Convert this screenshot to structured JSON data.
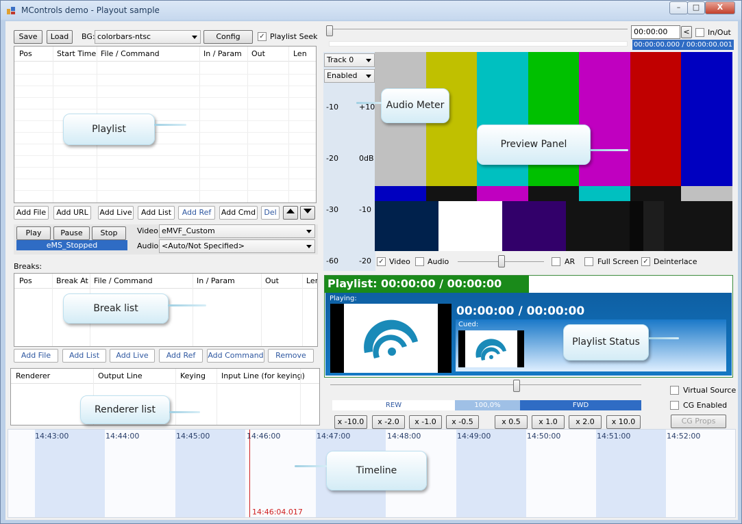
{
  "window": {
    "title": "MControls demo - Playout sample",
    "controls": {
      "minimize": "–",
      "maximize": "□",
      "close": "X"
    }
  },
  "toolbar": {
    "save": "Save",
    "load": "Load",
    "bg_label": "BG:",
    "bg_value": "colorbars-ntsc",
    "config": "Config",
    "playlist_seek": "Playlist Seek"
  },
  "playlist": {
    "columns": [
      "Pos",
      "Start Time",
      "File / Command",
      "In / Param",
      "Out",
      "Len"
    ],
    "buttons": [
      "Add File",
      "Add URL",
      "Add Live",
      "Add List",
      "Add Ref",
      "Add Cmd",
      "Del"
    ]
  },
  "transport": {
    "play": "Play",
    "pause": "Pause",
    "stop": "Stop",
    "status": "eMS_Stopped",
    "video_label": "Video:",
    "video_value": "eMVF_Custom",
    "audio_label": "Audio:",
    "audio_value": "<Auto/Not Specified>"
  },
  "breaks": {
    "label": "Breaks:",
    "columns": [
      "Pos",
      "Break At",
      "File / Command",
      "In / Param",
      "Out",
      "Ler"
    ],
    "buttons": [
      "Add File",
      "Add List",
      "Add Live",
      "Add Ref",
      "Add Command",
      "Remove"
    ]
  },
  "renderer": {
    "columns": [
      "Renderer",
      "Output Line",
      "Keying",
      "Input Line (for keying)"
    ]
  },
  "seek": {
    "time": "00:00:00",
    "back": "<",
    "inout": "In/Out",
    "position": "00:00:00.000 / 00:00:00.001"
  },
  "preview": {
    "track": "Track 0",
    "enabled": "Enabled",
    "meter_left": [
      "-10",
      "-20",
      "-30",
      "-60"
    ],
    "meter_right": [
      "+10",
      "0dB",
      "-10",
      "-20"
    ],
    "checks": {
      "video": "Video",
      "audio": "Audio",
      "ar": "AR",
      "fullscreen": "Full Screen",
      "deinterlace": "Deinterlace"
    },
    "bars_top": [
      "#c0c0c0",
      "#c0c000",
      "#00c0c0",
      "#00c000",
      "#c000c0",
      "#c00000",
      "#0000c0"
    ],
    "bars_mid": [
      "#0000c0",
      "#131313",
      "#c000c0",
      "#131313",
      "#00c0c0",
      "#131313",
      "#c0c0c0"
    ],
    "bars_bottom": [
      "#00214c",
      "#ffffff",
      "#32006a",
      "#131313",
      "#090909",
      "#1d1d1d",
      "#131313"
    ]
  },
  "status": {
    "header": "Playlist: 00:00:00 / 00:00:00",
    "playing_label": "Playing:",
    "time": "00:00:00 / 00:00:00",
    "cued_label": "Cued:"
  },
  "speed": {
    "rew": "REW",
    "pct": "100,0%",
    "fwd": "FWD",
    "slow": [
      "x -10.0",
      "x -2.0",
      "x -1.0",
      "x -0.5"
    ],
    "fast": [
      "x 0.5",
      "x 1.0",
      "x 2.0",
      "x 10.0"
    ]
  },
  "side": {
    "virtual_source": "Virtual Source",
    "cg_enabled": "CG Enabled",
    "cg_props": "CG Props"
  },
  "timeline": {
    "ticks": [
      "14:43:00",
      "14:44:00",
      "14:45:00",
      "14:46:00",
      "14:47:00",
      "14:48:00",
      "14:49:00",
      "14:50:00",
      "14:51:00",
      "14:52:00"
    ],
    "cursor": "14:46:04.017"
  },
  "callouts": {
    "playlist": "Playlist",
    "audio_meter": "Audio Meter",
    "preview": "Preview Panel",
    "break_list": "Break list",
    "playlist_status": "Playlist Status",
    "renderer_list": "Renderer list",
    "timeline": "Timeline"
  }
}
